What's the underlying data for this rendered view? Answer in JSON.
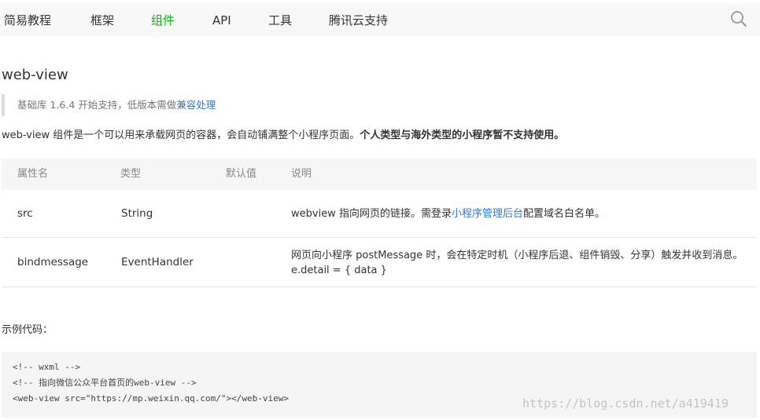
{
  "nav": {
    "items": [
      {
        "label": "简易教程",
        "active": false
      },
      {
        "label": "框架",
        "active": false
      },
      {
        "label": "组件",
        "active": true
      },
      {
        "label": "API",
        "active": false
      },
      {
        "label": "工具",
        "active": false
      },
      {
        "label": "腾讯云支持",
        "active": false
      }
    ],
    "search_icon": "search-icon",
    "active_color": "#1aad19"
  },
  "page": {
    "title": "web-view",
    "tip": {
      "prefix": "基础库 1.6.4 开始支持，低版本需做",
      "link": "兼容处理"
    },
    "description": {
      "text": "web-view 组件是一个可以用来承载网页的容器，会自动铺满整个小程序页面。",
      "bold": "个人类型与海外类型的小程序暂不支持使用。"
    },
    "link_color": "#3478c1"
  },
  "table": {
    "headers": [
      "属性名",
      "类型",
      "默认值",
      "说明"
    ],
    "rows": [
      {
        "name": "src",
        "type": "String",
        "default": "",
        "desc_before": "webview 指向网页的链接。需登录",
        "desc_link": "小程序管理后台",
        "desc_after": "配置域名白名单。"
      },
      {
        "name": "bindmessage",
        "type": "EventHandler",
        "default": "",
        "desc_before": "网页向小程序 postMessage 时，会在特定时机（小程序后退、组件销毁、分享）触发并收到消息。e.detail = { data }",
        "desc_link": "",
        "desc_after": ""
      }
    ]
  },
  "example": {
    "label": "示例代码：",
    "code_lines": [
      "<!-- wxml -->",
      "<!-- 指向微信公众平台首页的web-view -->",
      "<web-view src=\"https://mp.weixin.qq.com/\"></web-view>"
    ]
  },
  "watermark": "https://blog.csdn.net/a419419"
}
